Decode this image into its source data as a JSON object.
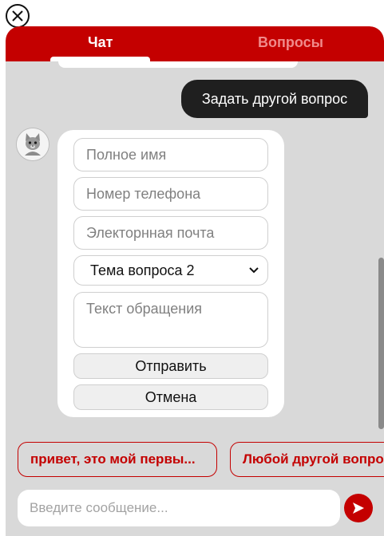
{
  "header": {
    "tabs": [
      {
        "label": "Чат",
        "active": true
      },
      {
        "label": "Вопросы",
        "active": false
      }
    ]
  },
  "messages": {
    "user_message": "Задать другой вопрос"
  },
  "form": {
    "name_placeholder": "Полное имя",
    "phone_placeholder": "Номер телефона",
    "email_placeholder": "Электорнная почта",
    "topic_selected": "Тема вопроса 2",
    "text_placeholder": "Текст обращения",
    "submit_label": "Отправить",
    "cancel_label": "Отмена"
  },
  "quick_replies": [
    {
      "label": "привет, это мой первы..."
    },
    {
      "label": "Любой другой вопрос"
    }
  ],
  "composer": {
    "placeholder": "Введите сообщение..."
  },
  "icons": {
    "close": "close-icon",
    "avatar": "cat-avatar",
    "dropdown": "chevron-down-icon",
    "send": "send-icon"
  },
  "colors": {
    "brand": "#c40000",
    "background": "#d9d9d9",
    "user_bubble": "#1f1f1f"
  }
}
